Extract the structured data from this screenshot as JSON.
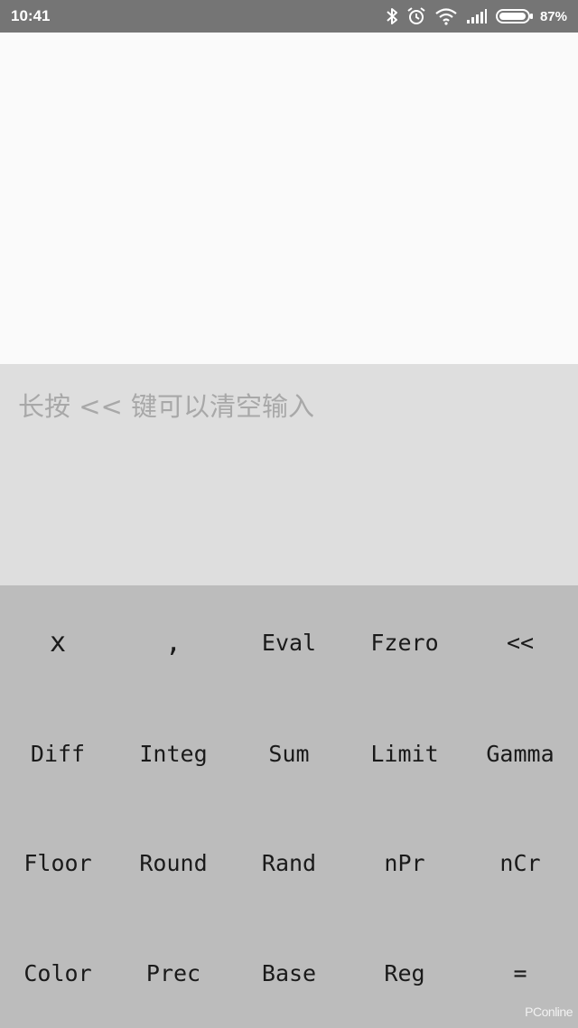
{
  "status_bar": {
    "time": "10:41",
    "battery_percent": "87%",
    "icons": [
      "bluetooth-icon",
      "alarm-icon",
      "wifi-icon",
      "signal-icon",
      "battery-icon"
    ]
  },
  "input": {
    "value": "",
    "placeholder": "长按 << 键可以清空输入"
  },
  "keypad": {
    "rows": [
      [
        "x",
        ",",
        "Eval",
        "Fzero",
        "<<"
      ],
      [
        "Diff",
        "Integ",
        "Sum",
        "Limit",
        "Gamma"
      ],
      [
        "Floor",
        "Round",
        "Rand",
        "nPr",
        "nCr"
      ],
      [
        "Color",
        "Prec",
        "Base",
        "Reg",
        "="
      ]
    ]
  },
  "watermark": "PConline",
  "colors": {
    "status_bar": "#757575",
    "result_bg": "#fafafa",
    "input_bg": "#dedede",
    "keypad_bg": "#bcbcbc",
    "key_text": "#1a1a1a",
    "placeholder": "#a8a8a8"
  }
}
